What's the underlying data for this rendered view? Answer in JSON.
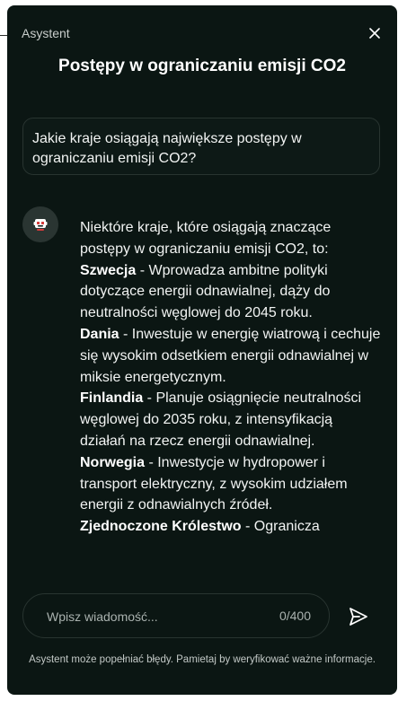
{
  "header": {
    "app_label": "Asystent",
    "title": "Postępy w ograniczaniu emisji CO2"
  },
  "icons": {
    "close": "close-icon",
    "avatar": "robot-avatar-icon",
    "send": "send-icon"
  },
  "conversation": {
    "user_message": "Jakie kraje osiągają największe postępy w ograniczaniu emisji CO2?",
    "bot_intro": "Niektóre kraje, które osiągają znaczące postępy w ograniczaniu emisji CO2, to:",
    "bot_items": [
      {
        "country": "Szwecja",
        "text": " - Wprowadza ambitne polityki dotyczące energii odnawialnej, dąży do neutralności węglowej do 2045 roku."
      },
      {
        "country": "Dania",
        "text": " - Inwestuje w energię wiatrową i cechuje się wysokim odsetkiem energii odnawialnej w miksie energetycznym."
      },
      {
        "country": "Finlandia",
        "text": " - Planuje osiągnięcie neutralności węglowej do 2035 roku, z intensyfikacją działań na rzecz energii odnawialnej."
      },
      {
        "country": "Norwegia",
        "text": " - Inwestycje w hydropower i transport elektryczny, z wysokim udziałem energii z odnawialnych źródeł."
      },
      {
        "country": "Zjednoczone Królestwo",
        "text": " - Ogranicza"
      }
    ]
  },
  "composer": {
    "placeholder": "Wpisz wiadomość...",
    "char_count": "0/400"
  },
  "footer": {
    "disclaimer": "Asystent może popełniać błędy. Pamietaj by weryfikować ważne informacje."
  },
  "colors": {
    "panel_bg": "#0b1613",
    "border": "#283430",
    "text": "#f2f4f3",
    "muted": "#aab2af"
  }
}
